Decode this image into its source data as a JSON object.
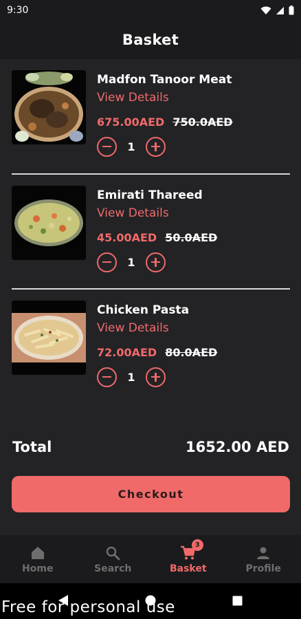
{
  "status_bar": {
    "time": "9:30"
  },
  "header": {
    "title": "Basket"
  },
  "items": [
    {
      "name": "Madfon Tanoor Meat",
      "details_label": "View Details",
      "price": "675.00AED",
      "old_price": "750.0AED",
      "quantity": "1"
    },
    {
      "name": "Emirati Thareed",
      "details_label": "View Details",
      "price": "45.00AED",
      "old_price": "50.0AED",
      "quantity": "1"
    },
    {
      "name": "Chicken Pasta",
      "details_label": "View Details",
      "price": "72.00AED",
      "old_price": "80.0AED",
      "quantity": "1"
    }
  ],
  "total": {
    "label": "Total",
    "value": "1652.00 AED"
  },
  "checkout": {
    "label": "Checkout"
  },
  "bottom_nav": {
    "items": [
      {
        "label": "Home",
        "icon": "home-icon"
      },
      {
        "label": "Search",
        "icon": "search-icon"
      },
      {
        "label": "Basket",
        "icon": "cart-icon",
        "badge": "3",
        "active": true
      },
      {
        "label": "Profile",
        "icon": "profile-icon"
      }
    ]
  },
  "watermark": "Free for personal use",
  "colors": {
    "accent": "#f06a6a",
    "background": "#232326",
    "bar": "#1b1b1d"
  }
}
